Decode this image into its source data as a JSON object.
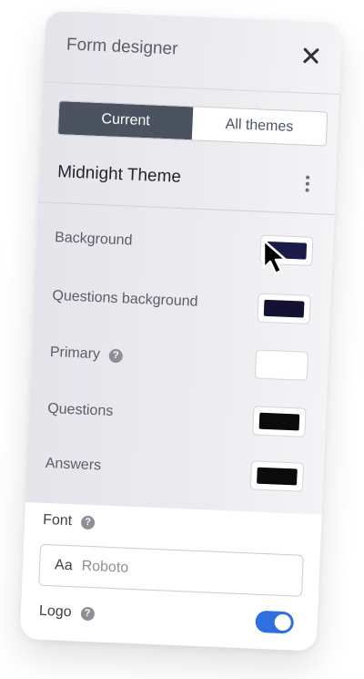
{
  "header": {
    "title": "Form designer"
  },
  "tabs": [
    {
      "label": "Current",
      "active": true
    },
    {
      "label": "All themes",
      "active": false
    }
  ],
  "theme": {
    "name": "Midnight Theme"
  },
  "colors": [
    {
      "label": "Background",
      "value": "#1c1a48",
      "help": false
    },
    {
      "label": "Questions background",
      "value": "#141232",
      "help": false
    },
    {
      "label": "Primary",
      "value": "#ffffff",
      "help": true
    },
    {
      "label": "Questions",
      "value": "#0b0b0b",
      "help": false
    },
    {
      "label": "Answers",
      "value": "#0b0b0b",
      "help": false
    }
  ],
  "font": {
    "label": "Font",
    "prefix": "Aa",
    "value": "Roboto"
  },
  "logo": {
    "label": "Logo",
    "enabled": true
  },
  "help_glyph": "?",
  "accent_color": "#2f6fe0"
}
